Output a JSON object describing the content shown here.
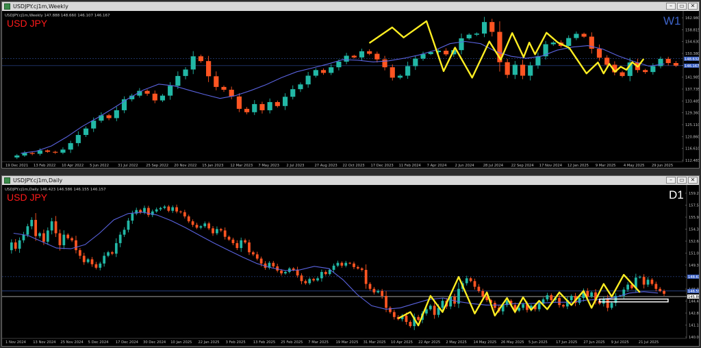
{
  "windows": [
    {
      "title": "USDJPY.cj1m,Weekly",
      "ohlc": "USDJPY.cj1m,Weekly  147.888 148.660 146.107 146.167",
      "symbol": "USD JPY",
      "timeframe": "W1",
      "timeframe_color": "#3d63c7",
      "buttons": [
        "–",
        "▭",
        "✕"
      ]
    },
    {
      "title": "USDJPY.cj1m,Daily",
      "ohlc": "USDJPY.cj1m,Daily  146.423 146.586 146.155 146.157",
      "symbol": "USD JPY",
      "timeframe": "D1",
      "timeframe_color": "#ffffff",
      "buttons": [
        "–",
        "▭",
        "✕"
      ]
    }
  ],
  "colors": {
    "bull": "#22b8a6",
    "bear": "#ff5522",
    "ma": "#5a63e0",
    "zigzag": "#ffee22",
    "grid": "#2b3a8a"
  },
  "chart_data": [
    {
      "type": "candlestick",
      "timeframe": "W1",
      "ylim": [
        112.483,
        163.205
      ],
      "price_ticks": [
        "162.980",
        "158.815",
        "154.630",
        "150.380",
        "146.167",
        "141.985",
        "137.735",
        "133.485",
        "129.360",
        "125.110",
        "120.860",
        "116.610",
        "112.483"
      ],
      "price_labels": [
        {
          "value": "148.632",
          "color": "#3d63c7"
        },
        {
          "value": "146.167",
          "color": "#3d63c7"
        }
      ],
      "time_ticks": [
        "19 Dec 2021",
        "13 Feb 2022",
        "10 Apr 2022",
        "5 Jun 2022",
        "31 Jul 2022",
        "25 Sep 2022",
        "20 Nov 2022",
        "15 Jan 2023",
        "12 Mar 2023",
        "7 May 2023",
        "2 Jul 2023",
        "27 Aug 2023",
        "22 Oct 2023",
        "17 Dec 2023",
        "11 Feb 2024",
        "7 Apr 2024",
        "2 Jun 2024",
        "28 Jul 2024",
        "22 Sep 2024",
        "17 Nov 2024",
        "12 Jan 2025",
        "9 Mar 2025",
        "4 May 2025",
        "29 Jun 2025"
      ],
      "path": [
        113.5,
        114.2,
        115.1,
        114.8,
        116.0,
        115.5,
        115.2,
        116.3,
        118.6,
        121.5,
        123.8,
        126.6,
        128.5,
        127.5,
        130.3,
        134.2,
        135.5,
        137.2,
        136.2,
        133.8,
        135.5,
        139.0,
        142.5,
        144.8,
        149.5,
        147.8,
        142.4,
        138.6,
        137.6,
        135.2,
        130.8,
        129.6,
        132.5,
        130.3,
        133.2,
        131.8,
        135.1,
        137.8,
        139.5,
        142.6,
        144.6,
        143.6,
        145.6,
        147.6,
        149.7,
        149.1,
        151.3,
        150.4,
        148.4,
        145.6,
        141.9,
        142.6,
        146.0,
        148.7,
        150.3,
        151.0,
        151.5,
        150.2,
        151.7,
        155.9,
        157.2,
        157.6,
        161.7,
        158.2,
        147.4,
        142.9,
        146.5,
        142.6,
        146.3,
        149.5,
        153.8,
        154.4,
        153.2,
        156.0,
        157.5,
        156.5,
        152.2,
        149.0,
        146.5,
        143.8,
        142.5,
        147.3,
        144.6,
        143.9,
        146.0,
        148.6,
        147.1,
        146.2
      ],
      "moving_average": [
        115.0,
        115.7,
        117.6,
        120.8,
        124.5,
        127.6,
        130.9,
        134.4,
        137.5,
        139.6,
        139.0,
        137.4,
        135.9,
        134.5,
        135.5,
        137.3,
        139.4,
        141.9,
        144.0,
        145.3,
        146.7,
        148.3,
        148.1,
        147.5,
        147.9,
        148.8,
        150.0,
        151.6,
        154.0,
        154.8,
        154.0,
        151.2,
        149.5,
        148.8,
        149.6,
        151.7,
        152.8,
        153.3,
        152.0,
        149.6,
        147.7,
        146.0,
        146.8
      ],
      "zigzag": [
        [
          63,
          154.2
        ],
        [
          67,
          159.8
        ],
        [
          69,
          156.2
        ],
        [
          73,
          162.0
        ],
        [
          76,
          144.2
        ],
        [
          78,
          152.6
        ],
        [
          81,
          141.9
        ],
        [
          84,
          154.8
        ],
        [
          86,
          148.3
        ],
        [
          88,
          157.8
        ],
        [
          90,
          149.2
        ],
        [
          91,
          154.4
        ],
        [
          92,
          150.2
        ],
        [
          94,
          157.9
        ],
        [
          96,
          154.4
        ],
        [
          98,
          152.5
        ],
        [
          101,
          143.4
        ],
        [
          103,
          147.3
        ],
        [
          104,
          143.4
        ],
        [
          105,
          146.8
        ],
        [
          106,
          144.0
        ],
        [
          107,
          145.8
        ],
        [
          108,
          144.7
        ],
        [
          109,
          147.4
        ],
        [
          110,
          145.8
        ],
        [
          111,
          148.6
        ]
      ]
    },
    {
      "type": "candlestick",
      "timeframe": "D1",
      "ylim": [
        140.05,
        160.5
      ],
      "price_ticks": [
        "159.216",
        "157.570",
        "155.926",
        "154.300",
        "152.640",
        "151.020",
        "149.355",
        "147.735",
        "146.090",
        "144.465",
        "142.830",
        "141.185",
        "140.050"
      ],
      "price_labels": [
        {
          "value": "148.632",
          "color": "#3d63c7"
        },
        {
          "value": "146.590",
          "color": "#3d63c7"
        },
        {
          "value": "145.804",
          "color": "#ffffff"
        }
      ],
      "time_ticks": [
        "1 Nov 2024",
        "13 Nov 2024",
        "25 Nov 2024",
        "5 Dec 2024",
        "17 Dec 2024",
        "30 Dec 2024",
        "10 Jan 2025",
        "22 Jan 2025",
        "3 Feb 2025",
        "13 Feb 2025",
        "25 Feb 2025",
        "7 Mar 2025",
        "19 Mar 2025",
        "31 Mar 2025",
        "10 Apr 2025",
        "22 Apr 2025",
        "2 May 2025",
        "14 May 2025",
        "26 May 2025",
        "5 Jun 2025",
        "17 Jun 2025",
        "27 Jun 2025",
        "9 Jul 2025",
        "21 Jul 2025"
      ],
      "path": [
        152.4,
        153.5,
        152.6,
        153.8,
        154.6,
        155.8,
        156.7,
        154.4,
        154.8,
        153.6,
        155.2,
        156.5,
        154.8,
        153.1,
        154.6,
        154.1,
        153.8,
        152.4,
        151.6,
        150.7,
        151.1,
        150.4,
        149.9,
        150.5,
        151.6,
        152.1,
        151.9,
        153.4,
        154.6,
        155.3,
        156.6,
        157.6,
        158.1,
        157.8,
        158.4,
        157.4,
        157.9,
        158.2,
        158.4,
        158.6,
        158.0,
        158.5,
        157.9,
        157.8,
        157.2,
        156.5,
        156.0,
        155.6,
        155.8,
        156.2,
        155.5,
        154.8,
        155.4,
        155.2,
        154.3,
        153.9,
        153.4,
        152.7,
        153.8,
        153.5,
        152.1,
        151.8,
        151.2,
        150.5,
        149.9,
        150.6,
        150.1,
        149.5,
        149.1,
        149.3,
        149.8,
        149.6,
        148.8,
        148.0,
        147.7,
        148.3,
        148.1,
        148.4,
        149.3,
        149.0,
        149.6,
        150.2,
        150.6,
        150.2,
        150.6,
        150.5,
        150.0,
        149.8,
        149.6,
        147.6,
        146.9,
        146.4,
        146.6,
        145.9,
        144.2,
        143.6,
        142.9,
        142.6,
        143.1,
        142.2,
        141.6,
        142.9,
        142.5,
        143.4,
        144.0,
        144.5,
        143.2,
        144.2,
        145.2,
        144.4,
        145.8,
        144.8,
        146.9,
        147.7,
        148.4,
        148.0,
        147.2,
        146.6,
        145.8,
        145.3,
        144.9,
        144.2,
        143.7,
        144.6,
        145.2,
        144.6,
        143.8,
        144.2,
        144.7,
        143.9,
        144.5,
        144.0,
        144.8,
        145.4,
        146.0,
        145.3,
        145.6,
        144.6,
        144.4,
        145.3,
        145.9,
        144.9,
        145.6,
        146.6,
        145.8,
        146.4,
        145.2,
        144.8,
        145.5,
        144.2,
        144.9,
        145.9,
        145.9,
        146.8,
        147.5,
        147.0,
        148.5,
        148.6,
        147.5,
        148.2,
        147.6,
        146.9,
        146.6,
        146.2
      ],
      "moving_average": [
        154.8,
        154.5,
        153.6,
        152.7,
        152.6,
        153.2,
        154.8,
        156.7,
        157.6,
        157.8,
        157.4,
        156.6,
        155.6,
        154.5,
        153.4,
        152.4,
        151.4,
        150.5,
        149.9,
        149.5,
        149.6,
        150.1,
        149.8,
        148.2,
        146.1,
        144.5,
        144.0,
        144.2,
        144.8,
        145.4,
        145.6,
        145.1,
        144.8,
        144.6,
        144.6,
        144.8,
        144.8,
        144.9,
        145.0,
        145.0,
        145.3,
        145.4,
        145.7,
        146.3,
        146.5,
        146.3
      ],
      "zigzag": [
        [
          97,
          142.7
        ],
        [
          100,
          143.6
        ],
        [
          102,
          141.7
        ],
        [
          105,
          145.9
        ],
        [
          108,
          143.6
        ],
        [
          112,
          148.6
        ],
        [
          116,
          143.4
        ],
        [
          119,
          146.4
        ],
        [
          121,
          143.1
        ],
        [
          124,
          145.6
        ],
        [
          126,
          143.6
        ],
        [
          128,
          145.7
        ],
        [
          130,
          143.9
        ],
        [
          132,
          145.2
        ],
        [
          134,
          144.0
        ],
        [
          137,
          146.4
        ],
        [
          140,
          144.6
        ],
        [
          143,
          146.6
        ],
        [
          145,
          144.2
        ],
        [
          148,
          147.6
        ],
        [
          150,
          145.8
        ],
        [
          153,
          148.9
        ],
        [
          157,
          146.4
        ]
      ],
      "rectangle": {
        "x0": 147,
        "x1": 164,
        "y0": 145.45,
        "y1": 145.05
      }
    }
  ]
}
